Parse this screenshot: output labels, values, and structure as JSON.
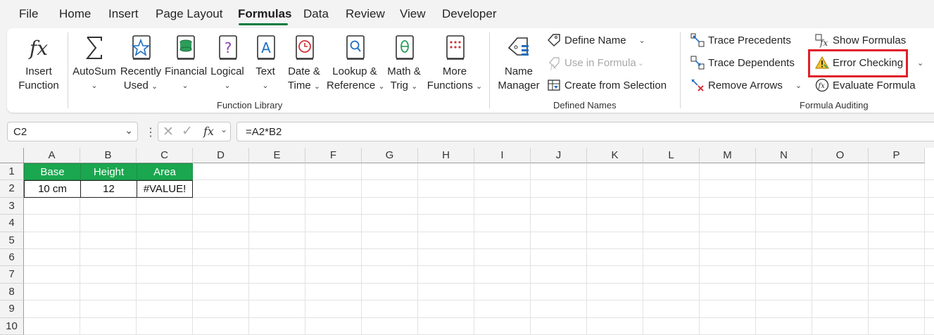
{
  "menu": {
    "tabs": [
      "File",
      "Home",
      "Insert",
      "Page Layout",
      "Formulas",
      "Data",
      "Review",
      "View",
      "Developer"
    ],
    "active": "Formulas"
  },
  "ribbon": {
    "function_library": {
      "label": "Function Library",
      "insert_function": [
        "Insert",
        "Function"
      ],
      "autosum": "AutoSum",
      "recently_used": [
        "Recently",
        "Used"
      ],
      "financial": "Financial",
      "logical": "Logical",
      "text": "Text",
      "date_time": [
        "Date &",
        "Time"
      ],
      "lookup_reference": [
        "Lookup &",
        "Reference"
      ],
      "math_trig": [
        "Math &",
        "Trig"
      ],
      "more_functions": [
        "More",
        "Functions"
      ]
    },
    "defined_names": {
      "label": "Defined Names",
      "name_manager": [
        "Name",
        "Manager"
      ],
      "define_name": "Define Name",
      "use_in_formula": "Use in Formula",
      "create_from_selection": "Create from Selection"
    },
    "formula_auditing": {
      "label": "Formula Auditing",
      "trace_precedents": "Trace Precedents",
      "trace_dependents": "Trace Dependents",
      "remove_arrows": "Remove Arrows",
      "show_formulas": "Show Formulas",
      "error_checking": "Error Checking",
      "evaluate_formula": "Evaluate Formula"
    }
  },
  "formula_bar": {
    "name_box": "C2",
    "fx": "fx",
    "formula": "=A2*B2"
  },
  "sheet": {
    "columns": [
      "A",
      "B",
      "C",
      "D",
      "E",
      "F",
      "G",
      "H",
      "I",
      "J",
      "K",
      "L",
      "M",
      "N",
      "O",
      "P"
    ],
    "rows": [
      "1",
      "2",
      "3",
      "4",
      "5",
      "6",
      "7",
      "8",
      "9",
      "10"
    ],
    "header_row": [
      "Base",
      "Height",
      "Area"
    ],
    "data_row": [
      "10 cm",
      "12",
      "#VALUE!"
    ]
  },
  "colors": {
    "accent": "#107c41",
    "header_fill": "#1aa74f",
    "highlight": "#e0202a"
  }
}
